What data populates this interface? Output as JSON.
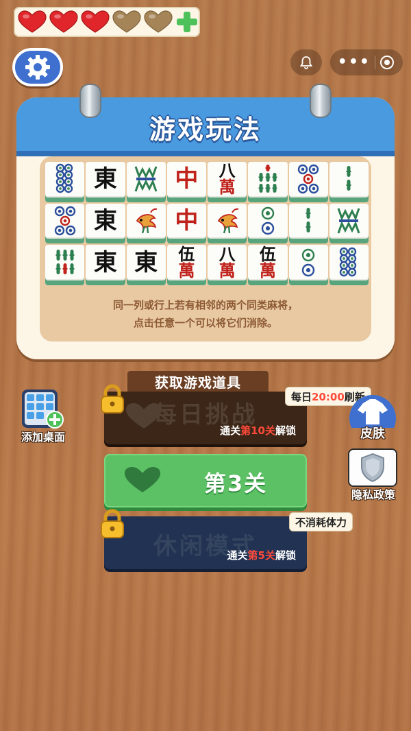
{
  "hud": {
    "hearts_full": 3,
    "hearts_total": 5,
    "add_icon": "plus-icon",
    "settings_icon": "gear-icon",
    "bell_icon": "bell-icon",
    "more_icon": "more-icon",
    "close_icon": "target-icon"
  },
  "card": {
    "title": "游戏玩法",
    "tiles": [
      [
        "8饼",
        "東",
        "WM",
        "中",
        "八萬",
        "7条",
        "5饼",
        "2条"
      ],
      [
        "5饼",
        "東",
        "幺鸡",
        "中",
        "幺鸡",
        "2饼",
        "2条",
        "WM"
      ],
      [
        "6条",
        "東",
        "東",
        "伍萬",
        "八萬",
        "伍萬",
        "2饼",
        "8饼"
      ]
    ],
    "desc_line1": "同一列或行上若有相邻的两个同类麻将，",
    "desc_line2": "点击任意一个可以将它们消除。"
  },
  "section_label": "获取游戏道具",
  "daily": {
    "label": "每日挑战",
    "unlock_prefix": "通关",
    "unlock_level": "第10关",
    "unlock_suffix": "解锁",
    "tag_prefix": "每日",
    "tag_time": "20:00",
    "tag_suffix": "刷新"
  },
  "level": {
    "label": "第3关"
  },
  "casual": {
    "label": "休闲模式",
    "unlock_prefix": "通关",
    "unlock_level": "第5关",
    "unlock_suffix": "解锁",
    "tag": "不消耗体力"
  },
  "side": {
    "add_desktop": "添加桌面",
    "skin": "皮肤",
    "privacy": "隐私政策"
  },
  "colors": {
    "heart_full": "#e0262b",
    "heart_empty": "#a58458",
    "accent_blue": "#4a9ae0",
    "green_button": "#5cc064",
    "highlight_red": "#ff4a3a"
  }
}
